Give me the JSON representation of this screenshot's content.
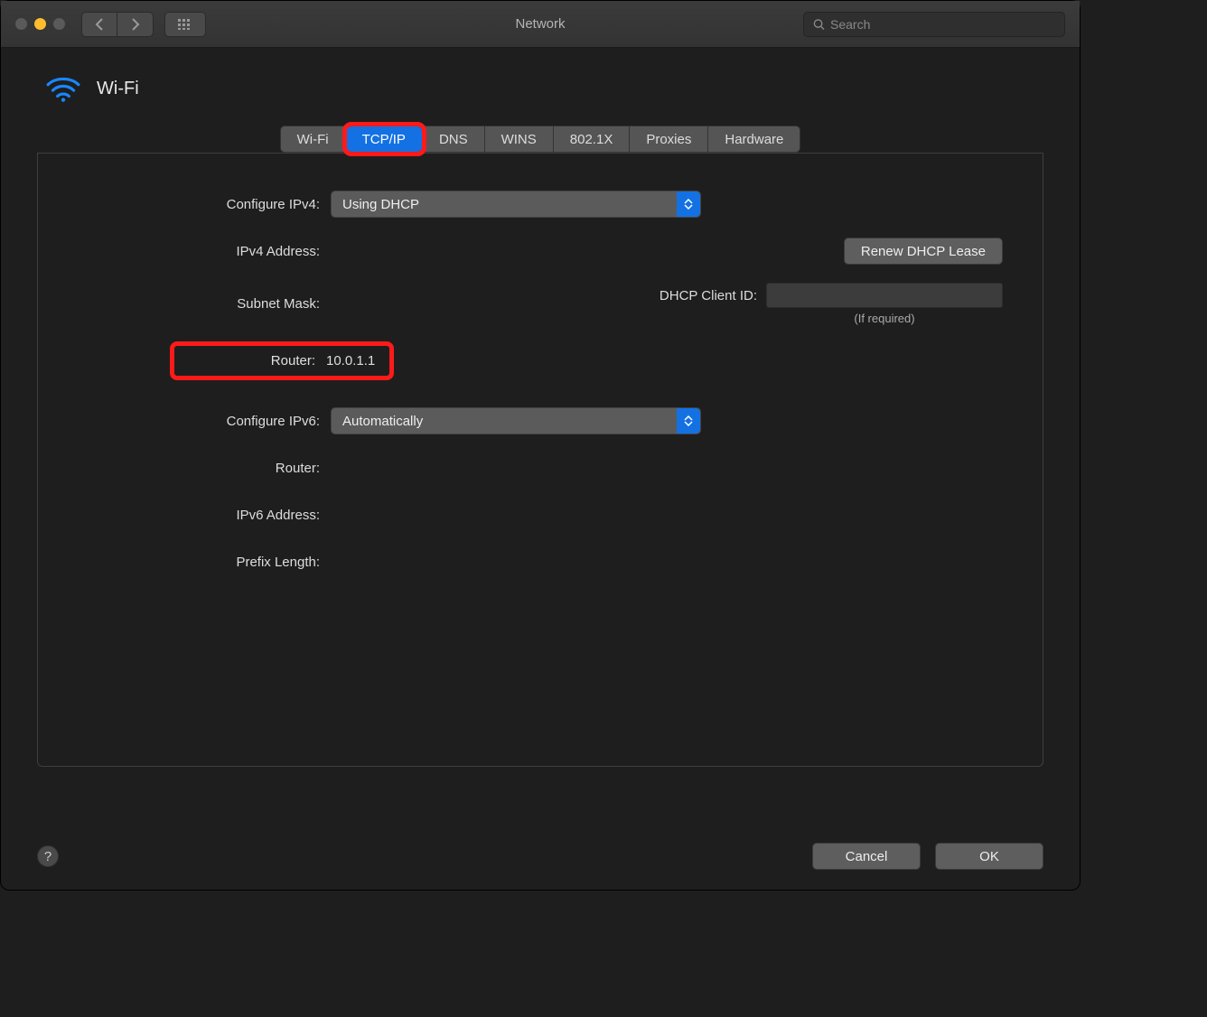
{
  "titlebar": {
    "title": "Network",
    "search_placeholder": "Search"
  },
  "header": {
    "title": "Wi-Fi"
  },
  "tabs": [
    {
      "label": "Wi-Fi",
      "active": false
    },
    {
      "label": "TCP/IP",
      "active": true,
      "highlight": true
    },
    {
      "label": "DNS",
      "active": false
    },
    {
      "label": "WINS",
      "active": false
    },
    {
      "label": "802.1X",
      "active": false
    },
    {
      "label": "Proxies",
      "active": false
    },
    {
      "label": "Hardware",
      "active": false
    }
  ],
  "form": {
    "configure_ipv4_label": "Configure IPv4:",
    "configure_ipv4_value": "Using DHCP",
    "ipv4_address_label": "IPv4 Address:",
    "ipv4_address_value": "",
    "subnet_mask_label": "Subnet Mask:",
    "subnet_mask_value": "",
    "router_label": "Router:",
    "router_value": "10.0.1.1",
    "dhcp_client_id_label": "DHCP Client ID:",
    "dhcp_client_id_value": "",
    "dhcp_client_id_hint": "(If required)",
    "renew_button": "Renew DHCP Lease",
    "configure_ipv6_label": "Configure IPv6:",
    "configure_ipv6_value": "Automatically",
    "router6_label": "Router:",
    "router6_value": "",
    "ipv6_address_label": "IPv6 Address:",
    "ipv6_address_value": "",
    "prefix_length_label": "Prefix Length:",
    "prefix_length_value": ""
  },
  "footer": {
    "help": "?",
    "cancel": "Cancel",
    "ok": "OK"
  }
}
